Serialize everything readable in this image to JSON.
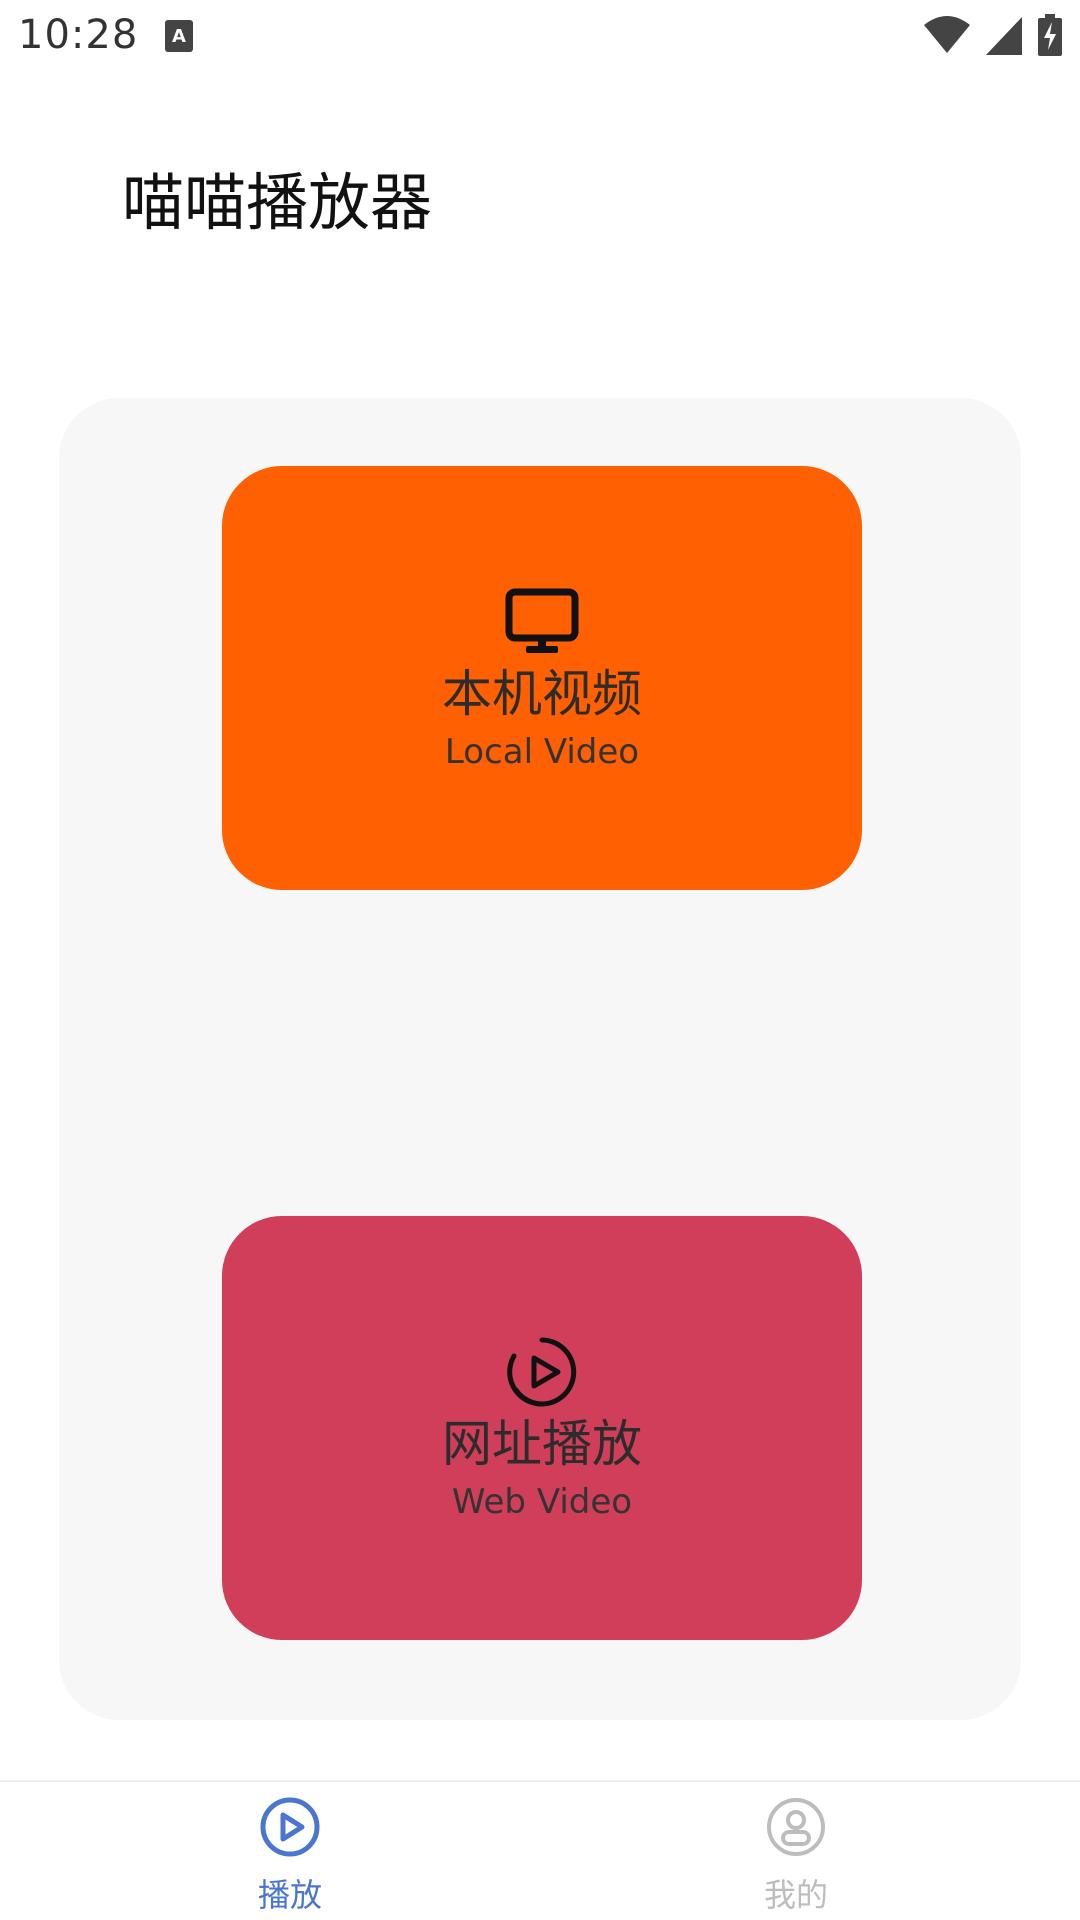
{
  "status_bar": {
    "time": "10:28",
    "icons": [
      "text-input-a-icon",
      "wifi-icon",
      "cellular-signal-icon",
      "battery-charging-icon"
    ]
  },
  "app": {
    "title": "喵喵播放器"
  },
  "cards": {
    "local": {
      "icon": "monitor-icon",
      "title": "本机视频",
      "subtitle": "Local Video",
      "color": "#ff6001"
    },
    "web": {
      "icon": "play-circle-icon",
      "title": "网址播放",
      "subtitle": "Web Video",
      "color": "#d13e59"
    }
  },
  "bottom_nav": {
    "items": [
      {
        "label": "播放",
        "icon": "play-circle-icon",
        "active": true,
        "color": "#4a76d1"
      },
      {
        "label": "我的",
        "icon": "user-icon",
        "active": false,
        "color": "#bdbdbd"
      }
    ]
  }
}
